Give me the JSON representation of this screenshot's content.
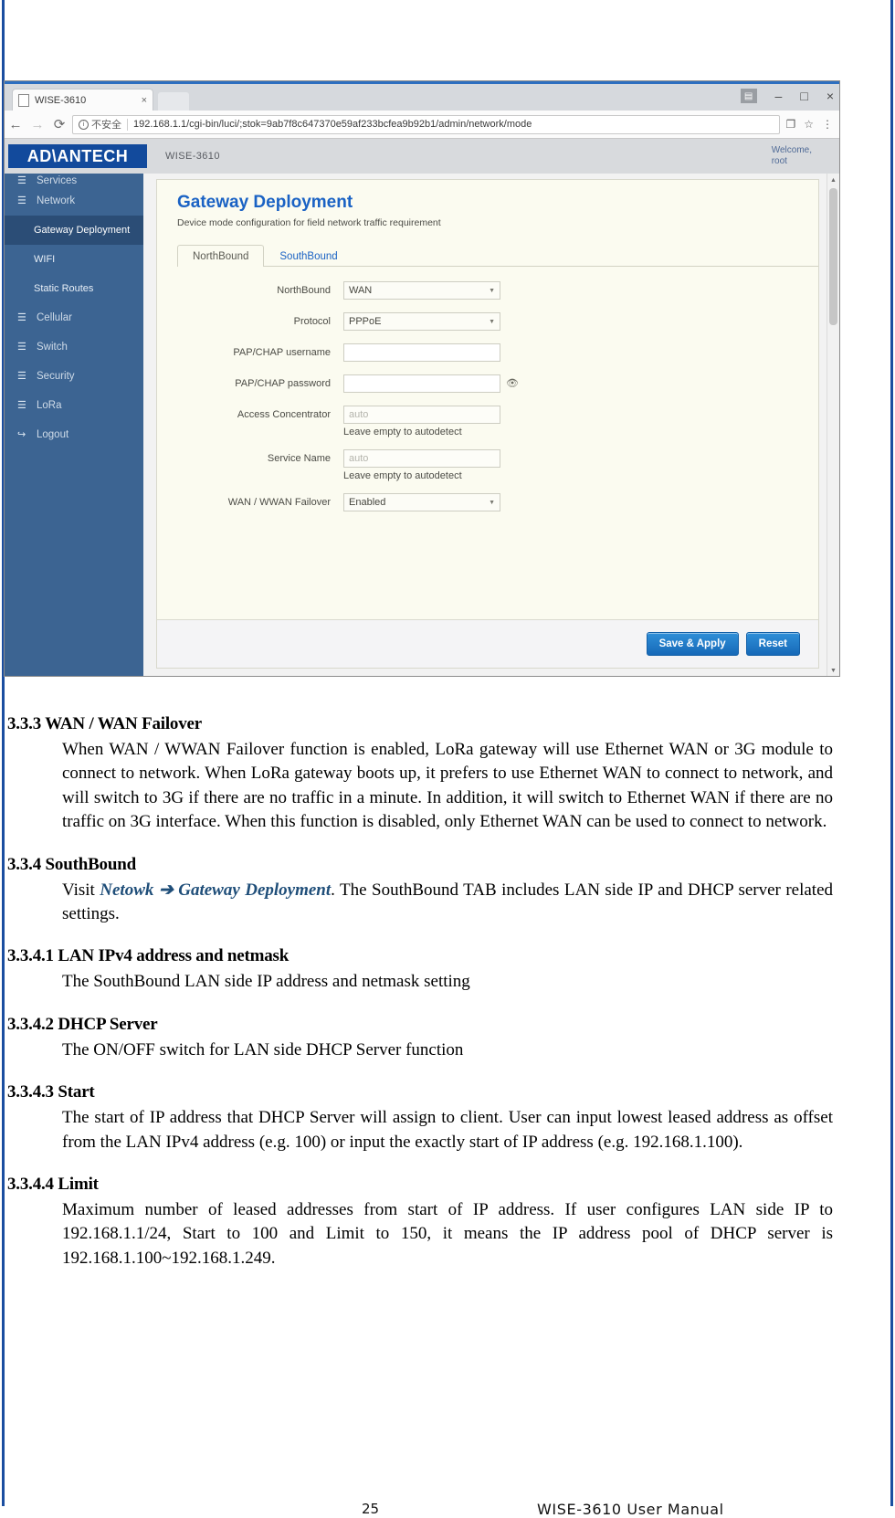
{
  "browser": {
    "tab": {
      "title": "WISE-3610",
      "close_label": "×",
      "favicon": "page-icon"
    },
    "window_controls": {
      "user": "▤",
      "minimize": "–",
      "maximize": "□",
      "close": "×"
    },
    "nav": {
      "back": "←",
      "forward": "→",
      "reload": "⟳"
    },
    "security": {
      "icon": "ⓘ",
      "label": "不安全"
    },
    "url": "192.168.1.1/cgi-bin/luci/;stok=9ab7f8c647370e59af233bcfea9b92b1/admin/network/mode",
    "omni_right": {
      "translate": "❐",
      "star": "☆",
      "menu": "⋮"
    }
  },
  "webapp": {
    "brand": "AD\\ANTECH",
    "model": "WISE-3610",
    "welcome_line1": "Welcome,",
    "welcome_line2": "root",
    "sidebar": [
      {
        "label": "Services",
        "glyph": "☰",
        "level": "top",
        "active": false,
        "clipped": true
      },
      {
        "label": "Network",
        "glyph": "☰",
        "level": "top",
        "active": false
      },
      {
        "label": "Gateway Deployment",
        "glyph": "",
        "level": "sub",
        "active": true
      },
      {
        "label": "WIFI",
        "glyph": "",
        "level": "sub",
        "active": false
      },
      {
        "label": "Static Routes",
        "glyph": "",
        "level": "sub",
        "active": false
      },
      {
        "label": "Cellular",
        "glyph": "☰",
        "level": "top",
        "active": false
      },
      {
        "label": "Switch",
        "glyph": "☰",
        "level": "top",
        "active": false
      },
      {
        "label": "Security",
        "glyph": "☰",
        "level": "top",
        "active": false
      },
      {
        "label": "LoRa",
        "glyph": "☰",
        "level": "top",
        "active": false
      },
      {
        "label": "Logout",
        "glyph": "↪",
        "level": "top",
        "active": false
      }
    ],
    "page": {
      "title": "Gateway Deployment",
      "subtitle": "Device mode configuration for field network traffic requirement",
      "tabs": [
        {
          "label": "NorthBound",
          "active": true
        },
        {
          "label": "SouthBound",
          "active": false
        }
      ],
      "fields": [
        {
          "label": "NorthBound",
          "type": "select",
          "value": "WAN"
        },
        {
          "label": "Protocol",
          "type": "select",
          "value": "PPPoE"
        },
        {
          "label": "PAP/CHAP username",
          "type": "text",
          "value": "",
          "placeholder": ""
        },
        {
          "label": "PAP/CHAP password",
          "type": "password",
          "value": "",
          "placeholder": "",
          "reveal": "ὄ1"
        },
        {
          "label": "Access Concentrator",
          "type": "text",
          "value": "",
          "placeholder": "auto",
          "hint": "Leave empty to autodetect"
        },
        {
          "label": "Service Name",
          "type": "text",
          "value": "",
          "placeholder": "auto",
          "hint": "Leave empty to autodetect"
        },
        {
          "label": "WAN / WWAN Failover",
          "type": "select",
          "value": "Enabled"
        }
      ],
      "buttons": {
        "save": "Save & Apply",
        "reset": "Reset"
      }
    },
    "scrollbar": {
      "up": "▲",
      "down": "▼"
    }
  },
  "document": {
    "sections": [
      {
        "heading": "3.3.3 WAN / WAN Failover",
        "body": "When WAN / WWAN Failover function is enabled, LoRa gateway will use Ethernet WAN or 3G module to connect to network. When LoRa gateway boots up, it prefers to use Ethernet WAN to connect to network, and will switch to 3G if there are no traffic in a minute. In addition, it will switch to Ethernet WAN if there are no traffic on 3G interface. When this function is disabled, only Ethernet WAN can be used to connect to network."
      },
      {
        "heading": "3.3.4 SouthBound",
        "body_pre": "Visit ",
        "link1": "Netowk",
        "arrow": " ➔ ",
        "link2": "Gateway Deployment",
        "body_post": ". The SouthBound TAB includes LAN side IP and DHCP server related settings."
      },
      {
        "heading": "3.3.4.1 LAN IPv4 address and netmask",
        "body": "The SouthBound LAN side IP address and netmask setting"
      },
      {
        "heading": "3.3.4.2 DHCP Server",
        "body": "The ON/OFF switch for LAN side DHCP Server function"
      },
      {
        "heading": "3.3.4.3 Start",
        "body": "The start of IP address that DHCP Server will assign to client. User can input lowest leased address as offset from the LAN IPv4 address (e.g. 100) or input the exactly start of IP address (e.g. 192.168.1.100)."
      },
      {
        "heading": "3.3.4.4 Limit",
        "body": "Maximum number of leased addresses from start of IP address. If user configures LAN side IP to 192.168.1.1/24, Start to 100 and Limit to 150, it means the IP address pool of DHCP server is 192.168.1.100~192.168.1.249."
      }
    ],
    "footer": {
      "page_number": "25",
      "manual": "WISE-3610  User  Manual"
    }
  },
  "colors": {
    "brand_blue": "#124a9c",
    "accent_blue": "#1a62c4",
    "sidebar_blue": "#3c6492",
    "sidebar_active": "#2b4d76",
    "panel_cream": "#fbfbf0",
    "button_blue": "#1769b8",
    "link_navy": "#1f4e79",
    "page_rule": "#1b4ea0"
  }
}
